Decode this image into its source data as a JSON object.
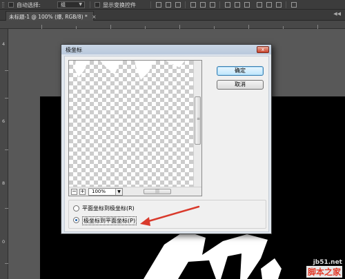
{
  "options_bar": {
    "auto_select_label": "自动选择:",
    "auto_select_value": "组",
    "show_transform_label": "显示变换控件"
  },
  "document_tab": {
    "title": "未标题-1 @ 100% (爆, RGB/8) *",
    "close_glyph": "×"
  },
  "rulers": {
    "left_numbers": [
      "4",
      "6",
      "8",
      "0"
    ]
  },
  "dialog": {
    "title": "极坐标",
    "close_glyph": "x",
    "ok_label": "确定",
    "cancel_label": "取消",
    "zoom_value": "100%",
    "zoom_out_glyph": "−",
    "zoom_in_glyph": "+",
    "options": [
      {
        "label": "平面坐标到极坐标(R)",
        "selected": false
      },
      {
        "label": "极坐标到平面坐标(P)",
        "selected": true
      }
    ]
  },
  "annotation": {
    "arrow_color": "#d93a2c"
  },
  "watermark": {
    "url": "jb51.net",
    "site_name": "脚本之家"
  }
}
